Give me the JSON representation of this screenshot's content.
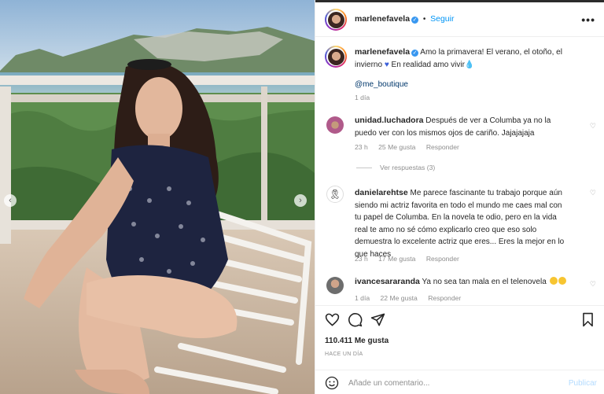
{
  "post": {
    "author": "marlenefavela",
    "follow_label": "Seguir",
    "more_label": "•••"
  },
  "caption": {
    "username": "marlenefavela",
    "text_1": "Amo la primavera! El verano, el otoño, el",
    "text_2": "invierno",
    "text_3": "En realidad amo vivir",
    "mention": "@me_boutique",
    "age": "1 día"
  },
  "comments": [
    {
      "username": "unidad.luchadora",
      "line_1": "Después de ver a Columba ya no la",
      "line_2": "puedo ver con los mismos ojos de cariño. Jajajajaja",
      "age": "23 h",
      "likes": "25 Me gusta",
      "reply": "Responder"
    },
    {
      "username": "danielarehtse",
      "line_1": "Me parece fascinante tu trabajo porque aún",
      "line_2": "siendo mi actriz favorita en todo el mundo me caes mal con",
      "line_3": "tu papel de Columba. En la novela te odio, pero en la vida",
      "line_4": "real te amo no sé cómo explicarlo creo que eso solo",
      "line_5": "demuestra lo excelente actriz que eres... Eres la mejor en lo",
      "line_6": "que haces",
      "age": "23 h",
      "likes": "17 Me gusta",
      "reply": "Responder"
    },
    {
      "username": "ivancesararanda",
      "line_1": "Ya no sea tan mala en el telenovela",
      "age": "1 día",
      "likes": "22 Me gusta",
      "reply": "Responder"
    }
  ],
  "view_replies": "Ver respuestas (3)",
  "likes_count": "110.411 Me gusta",
  "post_date": "HACE UN DÍA",
  "add_comment": {
    "placeholder": "Añade un comentario...",
    "publish": "Publicar"
  },
  "icons": {
    "nav_prev": "chevron-left-icon",
    "nav_next": "chevron-right-icon",
    "like": "heart-icon",
    "comment": "comment-bubble-icon",
    "share": "paper-plane-icon",
    "save": "bookmark-icon",
    "emoji": "smiley-icon"
  },
  "colors": {
    "link_blue": "#0095f6",
    "verified_blue": "#3897f0",
    "muted": "#8e8e8e"
  }
}
